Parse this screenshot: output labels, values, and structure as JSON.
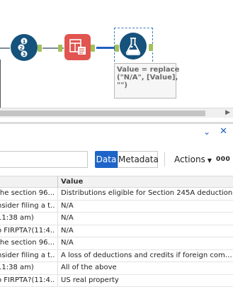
{
  "canvas": {
    "tools": [
      {
        "name": "record-id-tool",
        "icon": "numbered-list-icon"
      },
      {
        "name": "multi-field-tool",
        "icon": "table-formula-icon"
      },
      {
        "name": "formula-tool",
        "icon": "flask-icon"
      }
    ],
    "annotation": {
      "line1": "Value = replace",
      "line2": "(\"N/A\", [Value],",
      "line3": "\"\")"
    },
    "colors": {
      "tool_blue": "#15527c",
      "tool_red": "#e0554f",
      "anchor_green": "#a4c05a",
      "connection_selected": "#1f5fbf"
    }
  },
  "results": {
    "toggle": {
      "data_label": "Data",
      "metadata_label": "Metadata",
      "selected": "Data"
    },
    "actions_label": "Actions",
    "more_label": "000",
    "columns": [
      "",
      "Value"
    ],
    "rows": [
      {
        "c1": "the section 96...",
        "c2": "Distributions eligible for Section 245A deduction"
      },
      {
        "c1": "nsider filing a t...",
        "c2": "N/A"
      },
      {
        "c1": " 11:38 am)",
        "c2": "N/A"
      },
      {
        "c1": "o FIRPTA?(11:4...",
        "c2": "N/A"
      },
      {
        "c1": "the section 96...",
        "c2": "N/A"
      },
      {
        "c1": "nsider filing a t...",
        "c2": "A loss of deductions and credits if foreign compa..."
      },
      {
        "c1": " 11:38 am)",
        "c2": "All of the above"
      },
      {
        "c1": "o FIRPTA?(11:4...",
        "c2": "US real property"
      }
    ],
    "accent_color": "#1e64c8"
  }
}
